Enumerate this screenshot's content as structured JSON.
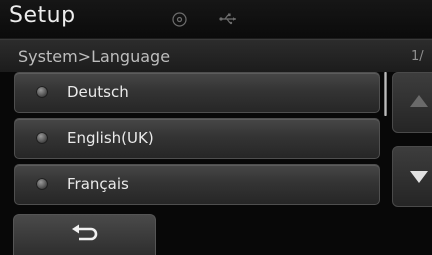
{
  "header": {
    "title": "Setup",
    "icons": [
      "disc-icon",
      "usb-icon"
    ]
  },
  "subheader": {
    "breadcrumb": "System>Language",
    "page_indicator": "1/"
  },
  "list": {
    "items": [
      {
        "label": "Deutsch",
        "selected": false
      },
      {
        "label": "English(UK)",
        "selected": false
      },
      {
        "label": "Français",
        "selected": false
      }
    ]
  },
  "scroll": {
    "up_icon": "triangle-up-icon",
    "down_icon": "triangle-down-icon",
    "up_enabled": false,
    "down_enabled": true
  },
  "footer": {
    "back_icon": "return-arrow-icon"
  },
  "colors": {
    "background": "#080808",
    "text": "#eaeaea",
    "disabled_arrow": "#6a6a6a"
  }
}
